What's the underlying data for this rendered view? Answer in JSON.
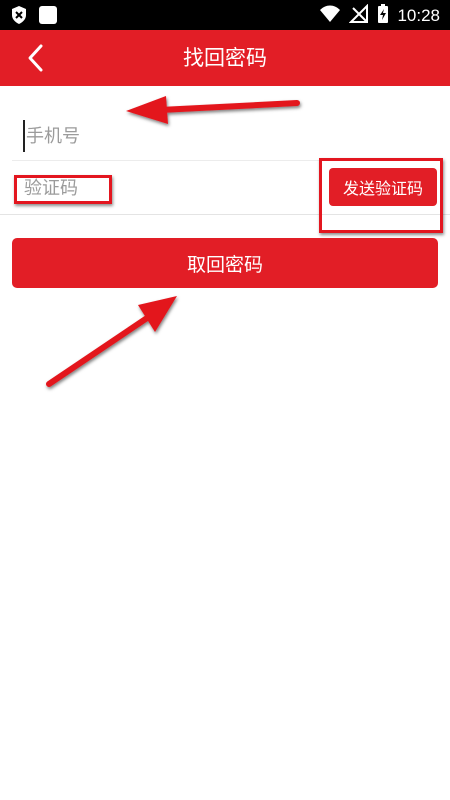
{
  "status_bar": {
    "time": "10:28",
    "left_icons": [
      "shield-icon",
      "square-notification-icon"
    ],
    "right_icons": [
      "wifi-icon",
      "no-signal-icon",
      "battery-charging-icon"
    ]
  },
  "app_bar": {
    "title": "找回密码",
    "back_icon": "chevron-left-icon"
  },
  "form": {
    "phone_placeholder": "手机号",
    "phone_value": "",
    "code_placeholder": "验证码",
    "code_value": "",
    "send_code_label": "发送验证码",
    "submit_label": "取回密码"
  },
  "colors": {
    "brand": "#e21e26",
    "annotation": "#e3161f",
    "placeholder": "#9b9b9b"
  }
}
